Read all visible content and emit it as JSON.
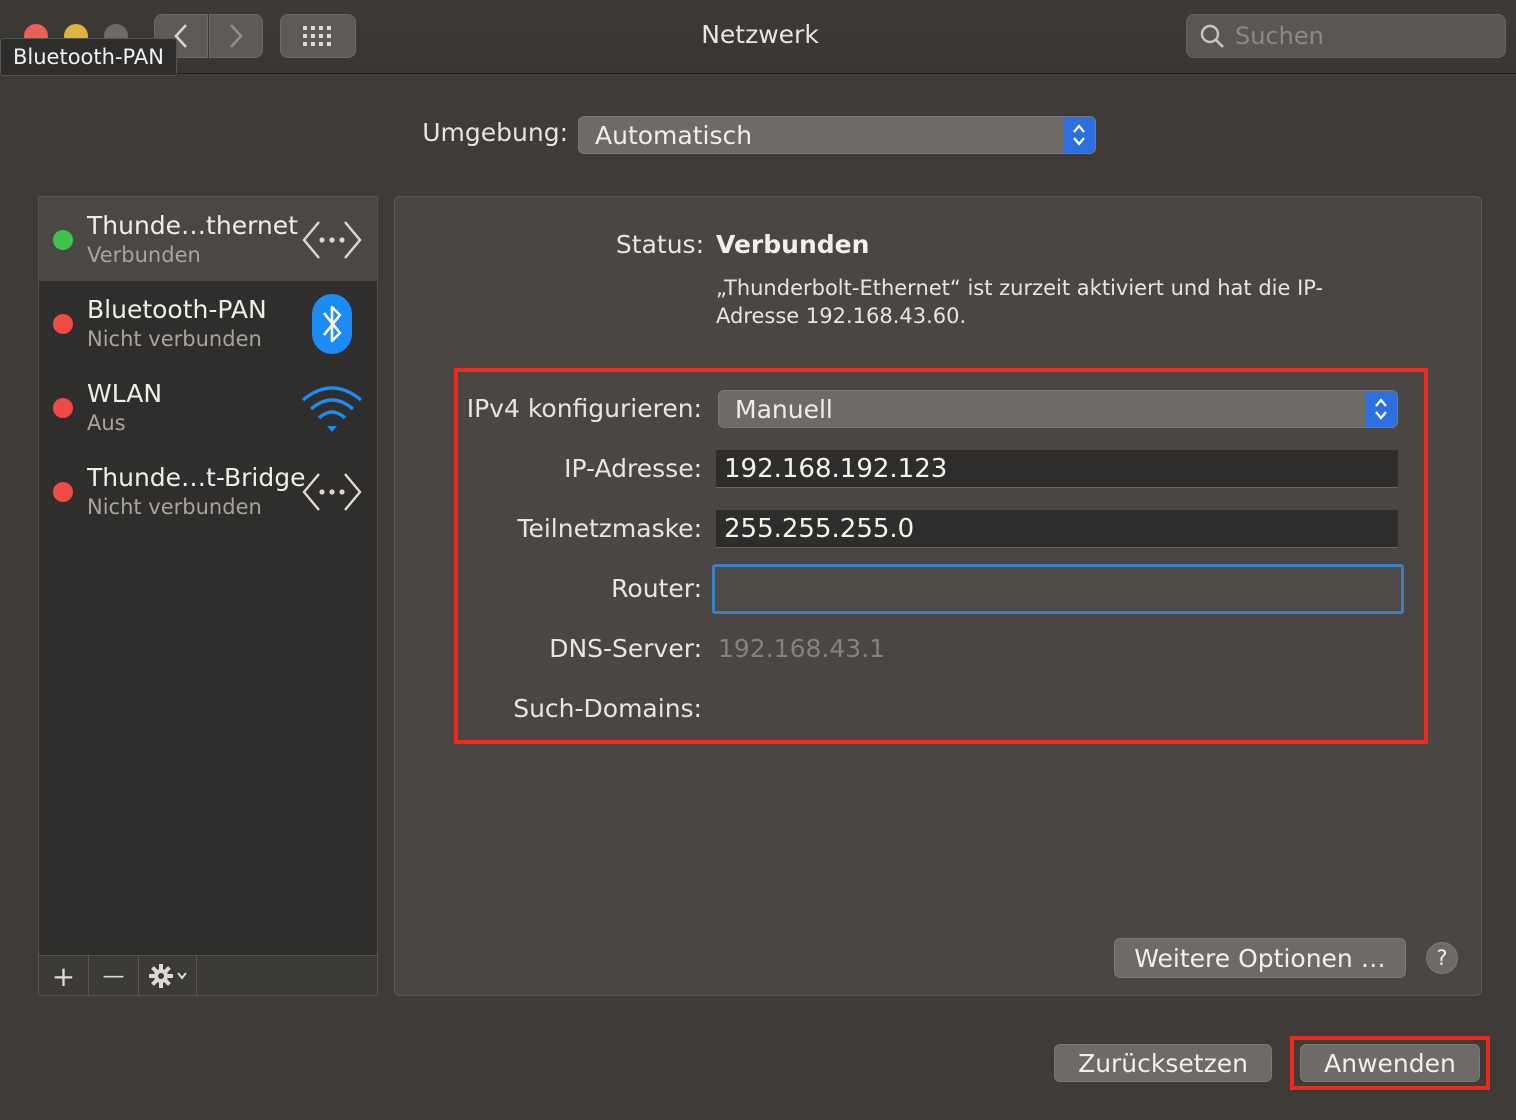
{
  "window": {
    "title": "Netzwerk",
    "search_placeholder": "Suchen",
    "tooltip": "Bluetooth-PAN",
    "traffic_colors": [
      "#ec5f56",
      "#e0b43c",
      "#6e6b67"
    ]
  },
  "location": {
    "label": "Umgebung:",
    "value": "Automatisch"
  },
  "services": [
    {
      "name": "Thunde…thernet",
      "status": "Verbunden",
      "dot": "#3fc14a",
      "icon": "ethernet-icon",
      "selected": true
    },
    {
      "name": "Bluetooth-PAN",
      "status": "Nicht verbunden",
      "dot": "#ee4b44",
      "icon": "bluetooth-icon",
      "selected": false
    },
    {
      "name": "WLAN",
      "status": "Aus",
      "dot": "#ee4b44",
      "icon": "wifi-icon",
      "selected": false
    },
    {
      "name": "Thunde…t-Bridge",
      "status": "Nicht verbunden",
      "dot": "#ee4b44",
      "icon": "ethernet-icon",
      "selected": false
    }
  ],
  "sidebar_toolbar": {
    "add": "+",
    "remove": "—",
    "action_icon": "gear-icon"
  },
  "detail": {
    "status_label": "Status:",
    "status_value": "Verbunden",
    "status_description": "„Thunderbolt-Ethernet“ ist zurzeit aktiviert und hat die IP-Adresse 192.168.43.60.",
    "ipv4_label": "IPv4 konfigurieren:",
    "ipv4_value": "Manuell",
    "ip_label": "IP-Adresse:",
    "ip_value": "192.168.192.123",
    "mask_label": "Teilnetzmaske:",
    "mask_value": "255.255.255.0",
    "router_label": "Router:",
    "router_value": "",
    "dns_label": "DNS-Server:",
    "dns_value": "192.168.43.1",
    "domains_label": "Such-Domains:",
    "more_options": "Weitere Optionen …",
    "help": "?"
  },
  "footer": {
    "reset": "Zurücksetzen",
    "apply": "Anwenden"
  },
  "colors": {
    "highlight": "#f0281c",
    "accent": "#2c6fe0"
  }
}
